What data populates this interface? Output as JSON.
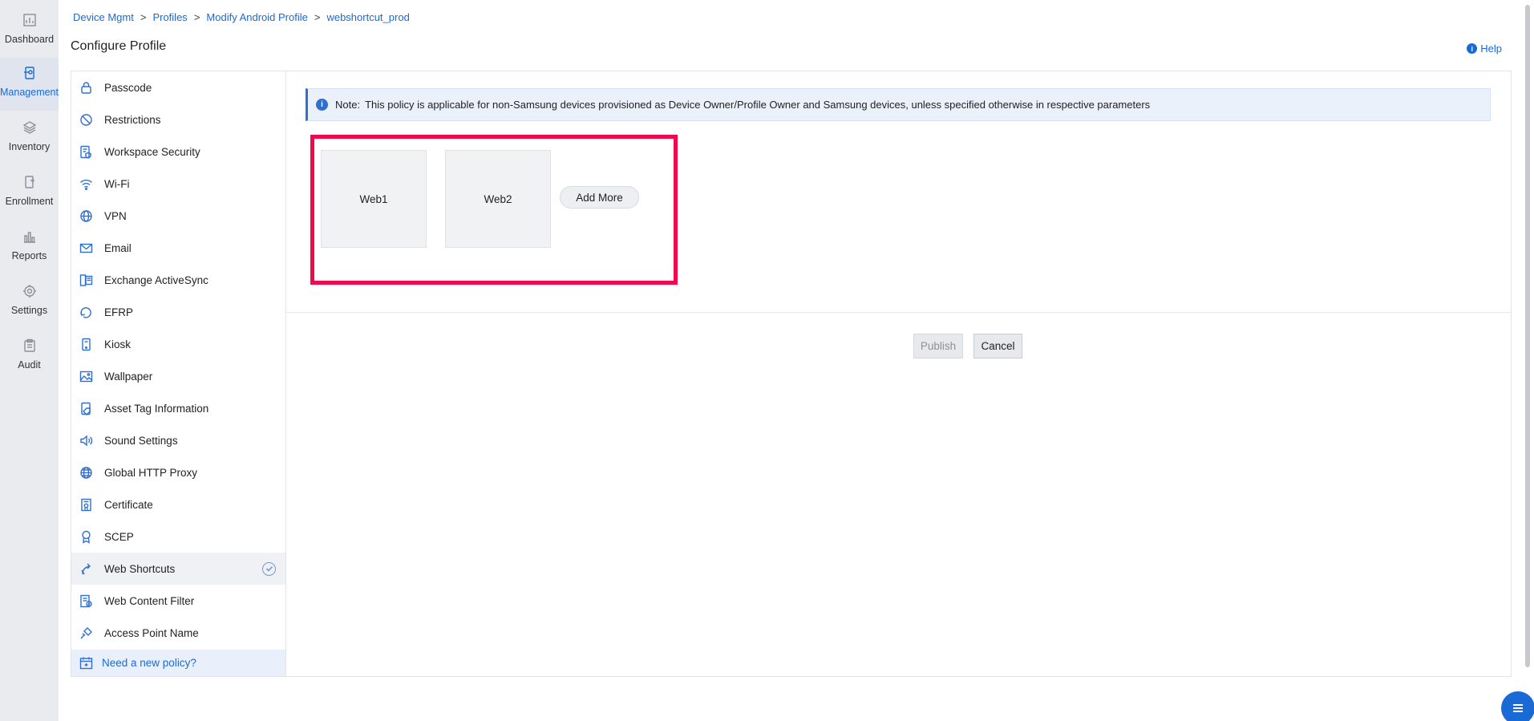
{
  "appnav": {
    "items": [
      {
        "label": "Dashboard",
        "icon": "dashboard-icon"
      },
      {
        "label": "Management",
        "icon": "management-icon"
      },
      {
        "label": "Inventory",
        "icon": "inventory-icon"
      },
      {
        "label": "Enrollment",
        "icon": "enrollment-icon"
      },
      {
        "label": "Reports",
        "icon": "reports-icon"
      },
      {
        "label": "Settings",
        "icon": "settings-icon"
      },
      {
        "label": "Audit",
        "icon": "audit-icon"
      }
    ],
    "active": "Management"
  },
  "breadcrumb": {
    "items": [
      "Device Mgmt",
      "Profiles",
      "Modify Android Profile",
      "webshortcut_prod"
    ],
    "separator": ">"
  },
  "page": {
    "title": "Configure Profile",
    "help_label": "Help",
    "help_icon_glyph": "i"
  },
  "policies": {
    "items": [
      {
        "label": "Passcode",
        "icon": "lock-icon"
      },
      {
        "label": "Restrictions",
        "icon": "restriction-icon"
      },
      {
        "label": "Workspace Security",
        "icon": "workspace-security-icon"
      },
      {
        "label": "Wi-Fi",
        "icon": "wifi-icon"
      },
      {
        "label": "VPN",
        "icon": "vpn-globe-icon"
      },
      {
        "label": "Email",
        "icon": "email-icon"
      },
      {
        "label": "Exchange ActiveSync",
        "icon": "exchange-icon"
      },
      {
        "label": "EFRP",
        "icon": "efrp-icon"
      },
      {
        "label": "Kiosk",
        "icon": "kiosk-icon"
      },
      {
        "label": "Wallpaper",
        "icon": "wallpaper-icon"
      },
      {
        "label": "Asset Tag Information",
        "icon": "asset-tag-icon"
      },
      {
        "label": "Sound Settings",
        "icon": "sound-icon"
      },
      {
        "label": "Global HTTP Proxy",
        "icon": "proxy-globe-icon"
      },
      {
        "label": "Certificate",
        "icon": "certificate-icon"
      },
      {
        "label": "SCEP",
        "icon": "scep-icon"
      },
      {
        "label": "Web Shortcuts",
        "icon": "web-shortcut-icon"
      },
      {
        "label": "Web Content Filter",
        "icon": "web-filter-icon"
      },
      {
        "label": "Access Point Name",
        "icon": "access-point-icon"
      }
    ],
    "selected": "Web Shortcuts",
    "new_policy_label": "Need a new policy?"
  },
  "note": {
    "label": "Note:",
    "text": "This policy is applicable for non-Samsung devices provisioned as Device Owner/Profile Owner and Samsung devices, unless specified otherwise in respective parameters",
    "icon_glyph": "i"
  },
  "shortcuts": {
    "cards": [
      "Web1",
      "Web2"
    ],
    "add_more_label": "Add More"
  },
  "actions": {
    "publish_label": "Publish",
    "cancel_label": "Cancel"
  },
  "colors": {
    "accent": "#1a6ad6",
    "highlight": "#f0094f",
    "nav_bg": "#e9ebef"
  }
}
